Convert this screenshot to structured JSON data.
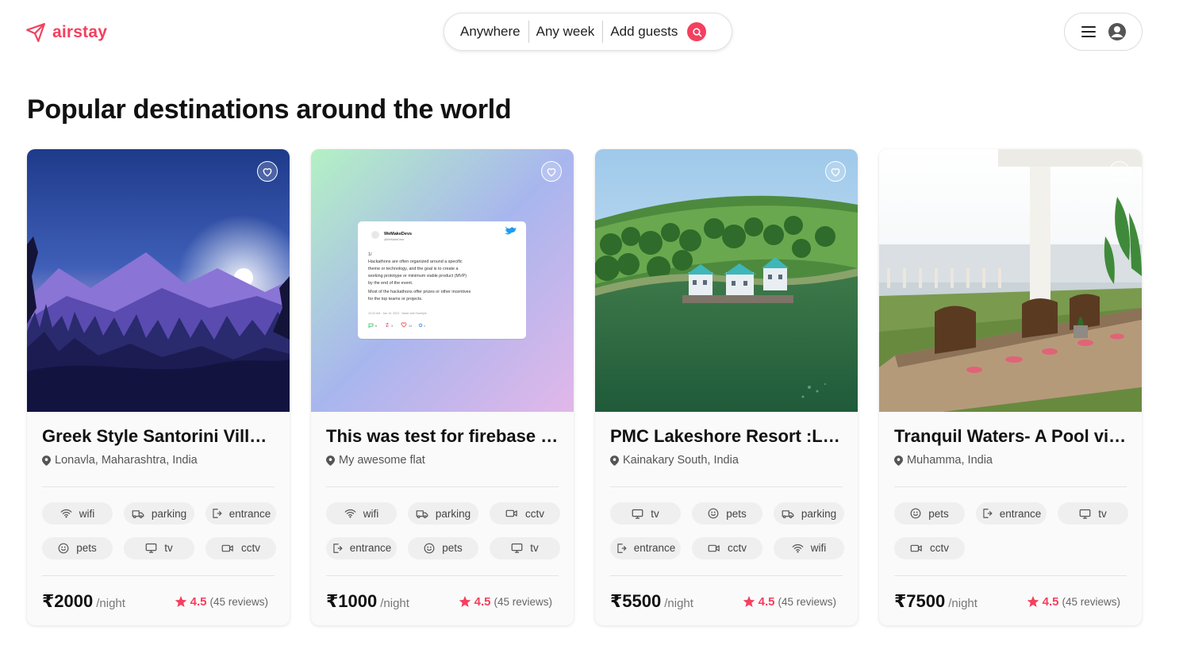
{
  "brand": {
    "name": "airstay",
    "accent": "#f43f5e"
  },
  "search": {
    "where": "Anywhere",
    "when": "Any week",
    "guests": "Add guests"
  },
  "page_title": "Popular destinations around the world",
  "tweet": {
    "author": "WeMakeDevs",
    "handle": "@WeMakeDevs",
    "lines": [
      "1/",
      "Hackathons are often organized around a specific",
      "theme or technology, and the goal is to create a",
      "working prototype or minimum viable product (MVP)",
      "by the end of the event.",
      "Most of the hackathons offer prizes or other incentives",
      "for the top teams or projects."
    ],
    "meta": "10:20 AM · Jan 10, 2023 · Made with Tweetpik",
    "stats": [
      "6",
      "3",
      "14",
      "1"
    ]
  },
  "cards": [
    {
      "title": "Greek Style Santorini Villa ...",
      "location": "Lonavla, Maharashtra, India",
      "amenities": [
        {
          "label": "wifi",
          "icon": "wifi-icon"
        },
        {
          "label": "parking",
          "icon": "car-icon"
        },
        {
          "label": "entrance",
          "icon": "door-icon"
        },
        {
          "label": "pets",
          "icon": "smile-icon"
        },
        {
          "label": "tv",
          "icon": "tv-icon"
        },
        {
          "label": "cctv",
          "icon": "camera-icon"
        }
      ],
      "price": "₹2000",
      "per": "/night",
      "rating": "4.5",
      "reviews": "(45 reviews)"
    },
    {
      "title": "This was test for firebase s...",
      "location": "My awesome flat",
      "amenities": [
        {
          "label": "wifi",
          "icon": "wifi-icon"
        },
        {
          "label": "parking",
          "icon": "car-icon"
        },
        {
          "label": "cctv",
          "icon": "camera-icon"
        },
        {
          "label": "entrance",
          "icon": "door-icon"
        },
        {
          "label": "pets",
          "icon": "smile-icon"
        },
        {
          "label": "tv",
          "icon": "tv-icon"
        }
      ],
      "price": "₹1000",
      "per": "/night",
      "rating": "4.5",
      "reviews": "(45 reviews)"
    },
    {
      "title": "PMC Lakeshore Resort :La...",
      "location": "Kainakary South, India",
      "amenities": [
        {
          "label": "tv",
          "icon": "tv-icon"
        },
        {
          "label": "pets",
          "icon": "smile-icon"
        },
        {
          "label": "parking",
          "icon": "car-icon"
        },
        {
          "label": "entrance",
          "icon": "door-icon"
        },
        {
          "label": "cctv",
          "icon": "camera-icon"
        },
        {
          "label": "wifi",
          "icon": "wifi-icon"
        }
      ],
      "price": "₹5500",
      "per": "/night",
      "rating": "4.5",
      "reviews": "(45 reviews)"
    },
    {
      "title": "Tranquil Waters- A Pool vil...",
      "location": "Muhamma, India",
      "amenities": [
        {
          "label": "pets",
          "icon": "smile-icon"
        },
        {
          "label": "entrance",
          "icon": "door-icon"
        },
        {
          "label": "tv",
          "icon": "tv-icon"
        },
        {
          "label": "cctv",
          "icon": "camera-icon"
        }
      ],
      "price": "₹7500",
      "per": "/night",
      "rating": "4.5",
      "reviews": "(45 reviews)"
    }
  ]
}
